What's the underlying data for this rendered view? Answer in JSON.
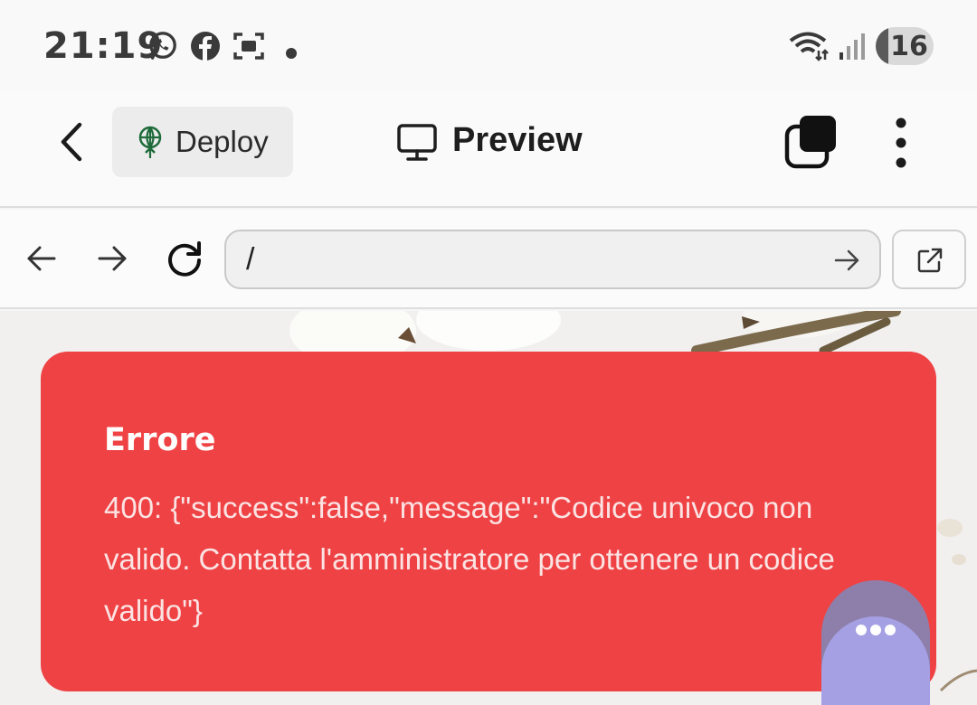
{
  "status_bar": {
    "time": "21:19",
    "icons": [
      "whatsapp-icon",
      "facebook-icon",
      "screenshot-icon",
      "notification-dot-icon",
      "wifi-icon",
      "signal-icon"
    ],
    "battery": "16"
  },
  "header": {
    "deploy_label": "Deploy",
    "preview_label": "Preview"
  },
  "browser": {
    "url": "/"
  },
  "error": {
    "title": "Errore",
    "message": "400: {\"success\":false,\"message\":\"Codice univoco non valido. Contatta l'amministratore per ottenere un codice valido\"}"
  },
  "colors": {
    "error_bg": "#ef4244",
    "deploy_icon": "#1f6b3a",
    "chat_fab": "#a5a0e3"
  }
}
